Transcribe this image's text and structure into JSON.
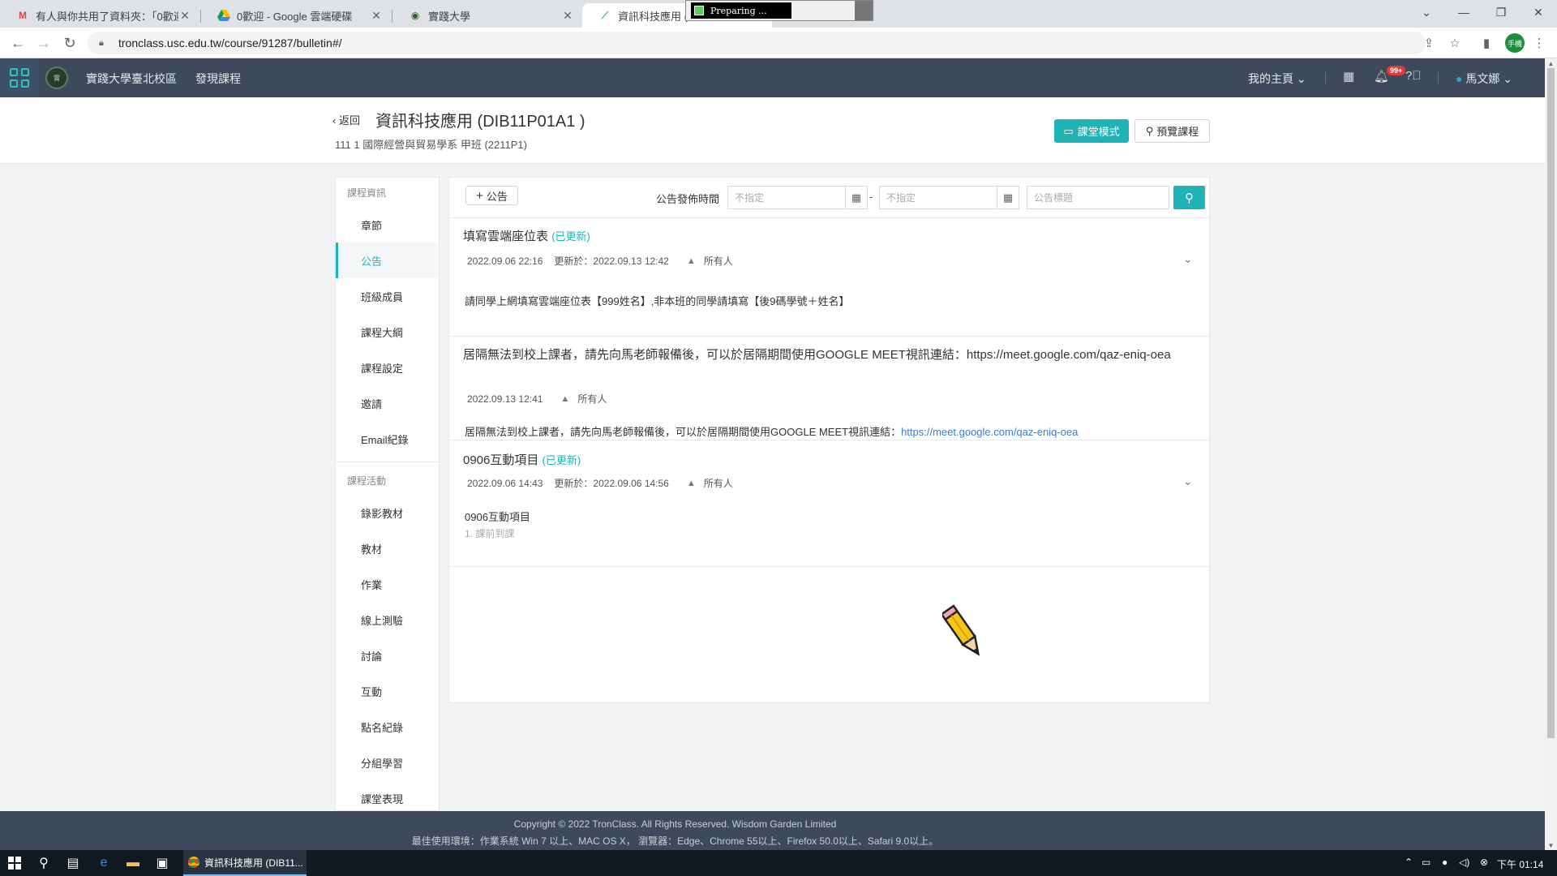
{
  "browser": {
    "tabs": [
      {
        "title": "有人與你共用了資料夾：「0歡迎",
        "icon": "gmail-icon"
      },
      {
        "title": "0歡迎 - Google 雲端硬碟",
        "icon": "google-drive-icon"
      },
      {
        "title": "實踐大學",
        "icon": "school-icon"
      },
      {
        "title": "資訊科技應用 (D",
        "icon": "tronclass-icon"
      }
    ],
    "preparing_text": "Preparing ...",
    "url": "tronclass.usc.edu.tw/course/91287/bulletin#/",
    "profile_label": "手機"
  },
  "appnav": {
    "school_name": "實踐大學臺北校區",
    "discover": "發現課程",
    "my_home": "我的主頁",
    "notification_count": "99+",
    "user_name": "馬文娜"
  },
  "course": {
    "back": "返回",
    "title": "資訊科技應用 (DIB11P01A1 )",
    "subtitle": "111 1 國際經營與貿易學系 甲班 (2211P1)",
    "class_mode": "課堂模式",
    "preview": "預覽課程"
  },
  "sidebar": {
    "group1": "課程資訊",
    "items1": [
      "章節",
      "公告",
      "班級成員",
      "課程大綱",
      "課程設定",
      "邀請",
      "Email紀錄"
    ],
    "group2": "課程活動",
    "items2": [
      "錄影教材",
      "教材",
      "作業",
      "線上測驗",
      "討論",
      "互動",
      "點名紀錄",
      "分組學習",
      "課堂表現"
    ]
  },
  "toolbar": {
    "add": "公告",
    "filter_label": "公告發佈時間",
    "date_from_placeholder": "不指定",
    "date_to_placeholder": "不指定",
    "dash": "-",
    "search_placeholder": "公告標題"
  },
  "posts": [
    {
      "title": "填寫雲端座位表",
      "updated": "(已更新)",
      "date": "2022.09.06 22:16",
      "updated_at": "更新於：2022.09.13 12:42",
      "audience": "所有人",
      "body": "請同學上網填寫雲端座位表【999姓名】,非本班的同學請填寫【後9碼學號＋姓名】"
    },
    {
      "title": "居隔無法到校上課者，請先向馬老師報備後，可以於居隔期間使用GOOGLE MEET視訊連結：https://meet.google.com/qaz-eniq-oea",
      "date": "2022.09.13 12:41",
      "audience": "所有人",
      "body": "居隔無法到校上課者，請先向馬老師報備後，可以於居隔期間使用GOOGLE MEET視訊連結：",
      "link": "https://meet.google.com/qaz-eniq-oea"
    },
    {
      "title": "0906互動項目",
      "updated": "(已更新)",
      "date": "2022.09.06 14:43",
      "updated_at": "更新於：2022.09.06 14:56",
      "audience": "所有人",
      "body": "0906互動項目",
      "sub": "1. 課前到課"
    }
  ],
  "footer": {
    "copyright": "Copyright © 2022 TronClass. All Rights Reserved. Wisdom Garden Limited",
    "env": "最佳使用環境：作業系統 Win 7 以上、MAC OS X， 瀏覽器：Edge、Chrome 55以上、Firefox 50.0以上、Safari 9.0以上。"
  },
  "taskbar": {
    "app_title": "資訊科技應用 (DIB11...",
    "clock": "下午 01:14"
  },
  "colors": {
    "accent": "#1fb3b5",
    "nav_bg": "#3e4a5b",
    "link": "#3a7bd5"
  }
}
